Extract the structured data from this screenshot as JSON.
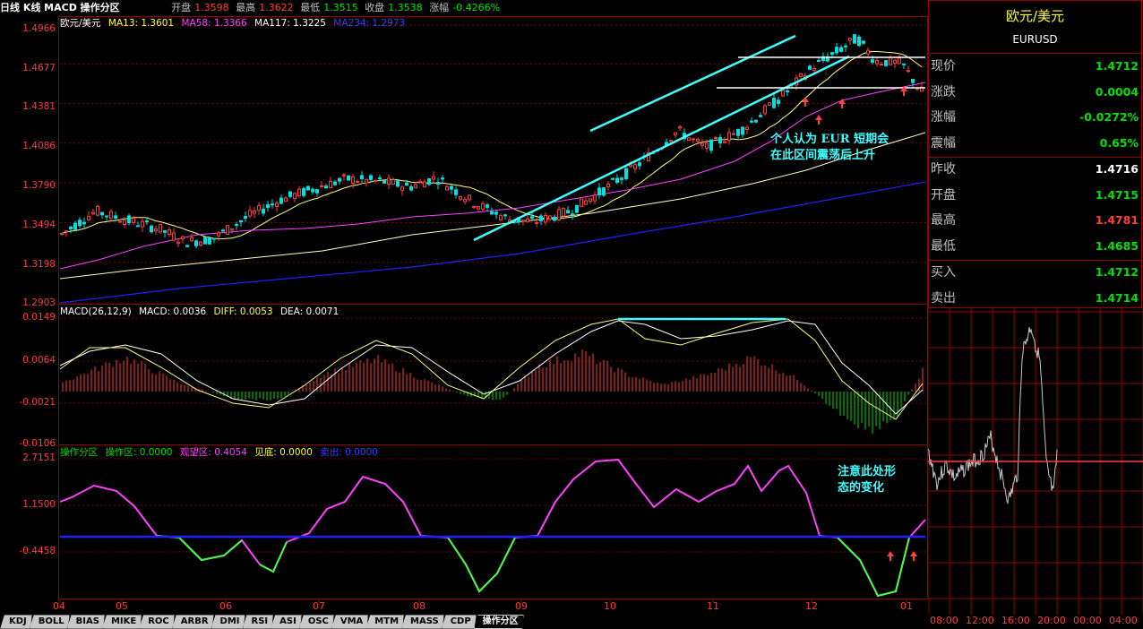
{
  "header": {
    "title": "日线 K线 MACD 操作分区",
    "open_label": "开盘",
    "open": "1.3598",
    "high_label": "最高",
    "high": "1.3622",
    "low_label": "最低",
    "low": "1.3515",
    "close_label": "收盘",
    "close": "1.3538",
    "change_label": "涨幅",
    "change": "-0.4266%"
  },
  "main_panel": {
    "legend": {
      "symbol": "欧元/美元",
      "ma13": "MA13: 1.3601",
      "ma58": "MA58: 1.3366",
      "ma117": "MA117: 1.3225",
      "ma234": "MA234: 1.2973"
    },
    "y_ticks": [
      "1.4966",
      "1.4677",
      "1.4381",
      "1.4086",
      "1.3790",
      "1.3494",
      "1.3198",
      "1.2903"
    ],
    "annotation_line1": "个人认为 EUR 短期会",
    "annotation_line2": "在此区间震荡后上升"
  },
  "macd_panel": {
    "legend": {
      "name": "MACD(26,12,9)",
      "macd": "MACD: 0.0036",
      "diff": "DIFF: 0.0053",
      "dea": "DEA: 0.0071"
    },
    "y_ticks": [
      "0.0149",
      "0.0064",
      "-0.0021",
      "-0.0106"
    ]
  },
  "zone_panel": {
    "legend": {
      "name": "操作分区",
      "op": "操作区: 0.0000",
      "watch": "观望区: 0.4054",
      "bottom": "见底: 0.0000",
      "sell": "卖出: 0.0000"
    },
    "y_ticks": [
      "2.7151",
      "1.1500",
      "-0.4458"
    ],
    "annotation_line1": "注意此处形",
    "annotation_line2": "态的变化"
  },
  "x_axis": [
    "04",
    "05",
    "06",
    "07",
    "08",
    "09",
    "10",
    "11",
    "12",
    "01"
  ],
  "quote": {
    "name": "欧元/美元",
    "code": "EURUSD",
    "rows": [
      {
        "label": "现价",
        "value": "1.4712",
        "color": "#00e000"
      },
      {
        "label": "涨跌",
        "value": "0.0004",
        "color": "#00e000"
      },
      {
        "label": "涨幅",
        "value": "-0.0272%",
        "color": "#00e000"
      },
      {
        "label": "震幅",
        "value": "0.65%",
        "color": "#00e000"
      },
      {
        "label": "昨收",
        "value": "1.4716",
        "color": "#ffffff"
      },
      {
        "label": "开盘",
        "value": "1.4715",
        "color": "#00e000"
      },
      {
        "label": "最高",
        "value": "1.4781",
        "color": "#ff3c3c"
      },
      {
        "label": "最低",
        "value": "1.4685",
        "color": "#00e000"
      },
      {
        "label": "买入",
        "value": "1.4712",
        "color": "#00e000"
      },
      {
        "label": "卖出",
        "value": "1.4714",
        "color": "#00e000"
      }
    ]
  },
  "intraday_times": [
    "08:00",
    "12:00",
    "16:00",
    "20:00",
    "00:00",
    "04:00"
  ],
  "tabs": [
    "KDJ",
    "BOLL",
    "BIAS",
    "MIKE",
    "ROC",
    "ARBR",
    "DMI",
    "RSI",
    "ASI",
    "OSC",
    "VMA",
    "MTM",
    "MASS",
    "CDP",
    "操作分区"
  ],
  "active_tab": "操作分区",
  "colors": {
    "up": "#ff3c3c",
    "down": "#00e0e0",
    "frame": "#9a0000",
    "trend": "#40ffff",
    "ma13": "#ffff80",
    "ma58": "#ff40ff",
    "ma117": "#ffffc0",
    "ma234": "#2020ff"
  }
}
